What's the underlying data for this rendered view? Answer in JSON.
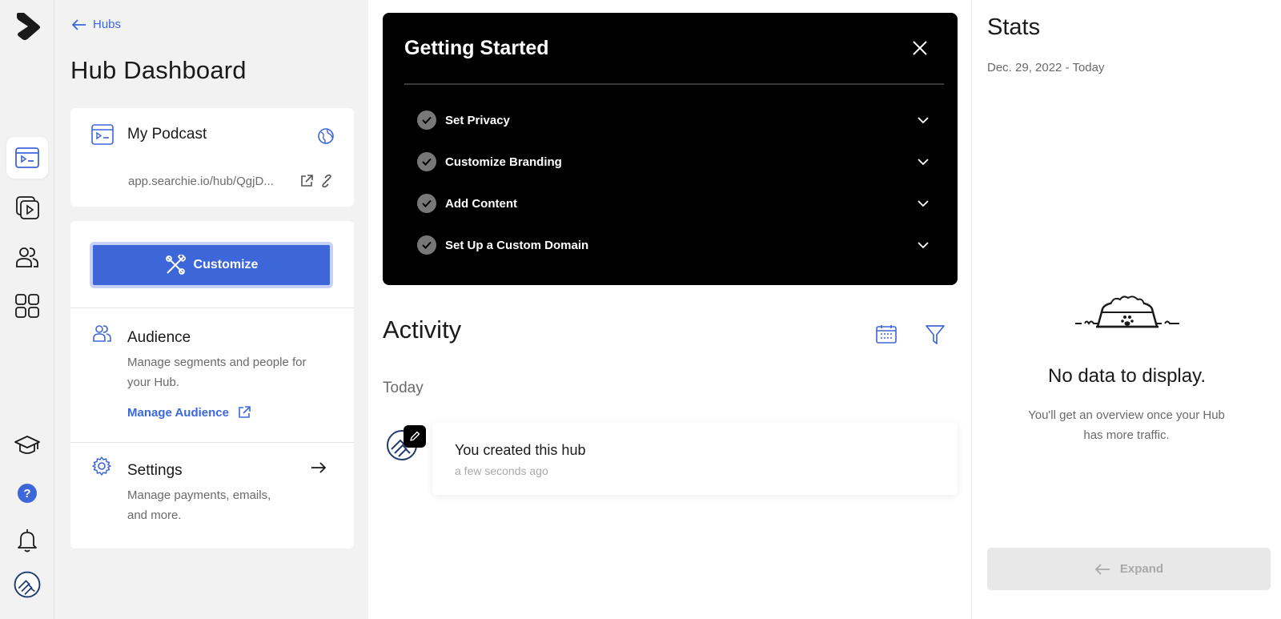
{
  "colors": {
    "accent": "#3d66d9",
    "rail_bg": "#f2f2f2",
    "dark_card": "#000000"
  },
  "rail": {
    "items": [
      {
        "name": "hub-dashboard",
        "icon": "podcast-card-icon",
        "active": true
      },
      {
        "name": "media",
        "icon": "video-library-icon",
        "active": false
      },
      {
        "name": "audience",
        "icon": "users-icon",
        "active": false
      },
      {
        "name": "apps",
        "icon": "grid-icon",
        "active": false
      },
      {
        "name": "learn",
        "icon": "graduation-cap-icon",
        "active": false
      },
      {
        "name": "help",
        "icon": "help-icon",
        "active": false
      },
      {
        "name": "notifications",
        "icon": "bell-icon",
        "active": false
      },
      {
        "name": "profile",
        "icon": "avatar-icon",
        "active": false
      }
    ]
  },
  "hub": {
    "back_label": "Hubs",
    "title": "Hub Dashboard",
    "podcast": {
      "name": "My Podcast",
      "url": "app.searchie.io/hub/QgjD..."
    },
    "customize_label": "Customize",
    "audience": {
      "title": "Audience",
      "desc": "Manage segments and people for your Hub.",
      "link": "Manage Audience"
    },
    "settings": {
      "title": "Settings",
      "desc": "Manage payments, emails, and more."
    }
  },
  "getting_started": {
    "title": "Getting Started",
    "items": [
      {
        "label": "Set Privacy"
      },
      {
        "label": "Customize Branding"
      },
      {
        "label": "Add Content"
      },
      {
        "label": "Set Up a Custom Domain"
      }
    ]
  },
  "activity": {
    "title": "Activity",
    "group": "Today",
    "entries": [
      {
        "text": "You created this hub",
        "time": "a few seconds ago"
      }
    ]
  },
  "stats": {
    "title": "Stats",
    "range": "Dec. 29, 2022 - Today",
    "empty_title": "No data to display.",
    "empty_desc": "You'll get an overview once your Hub has more traffic.",
    "expand_label": "Expand"
  }
}
